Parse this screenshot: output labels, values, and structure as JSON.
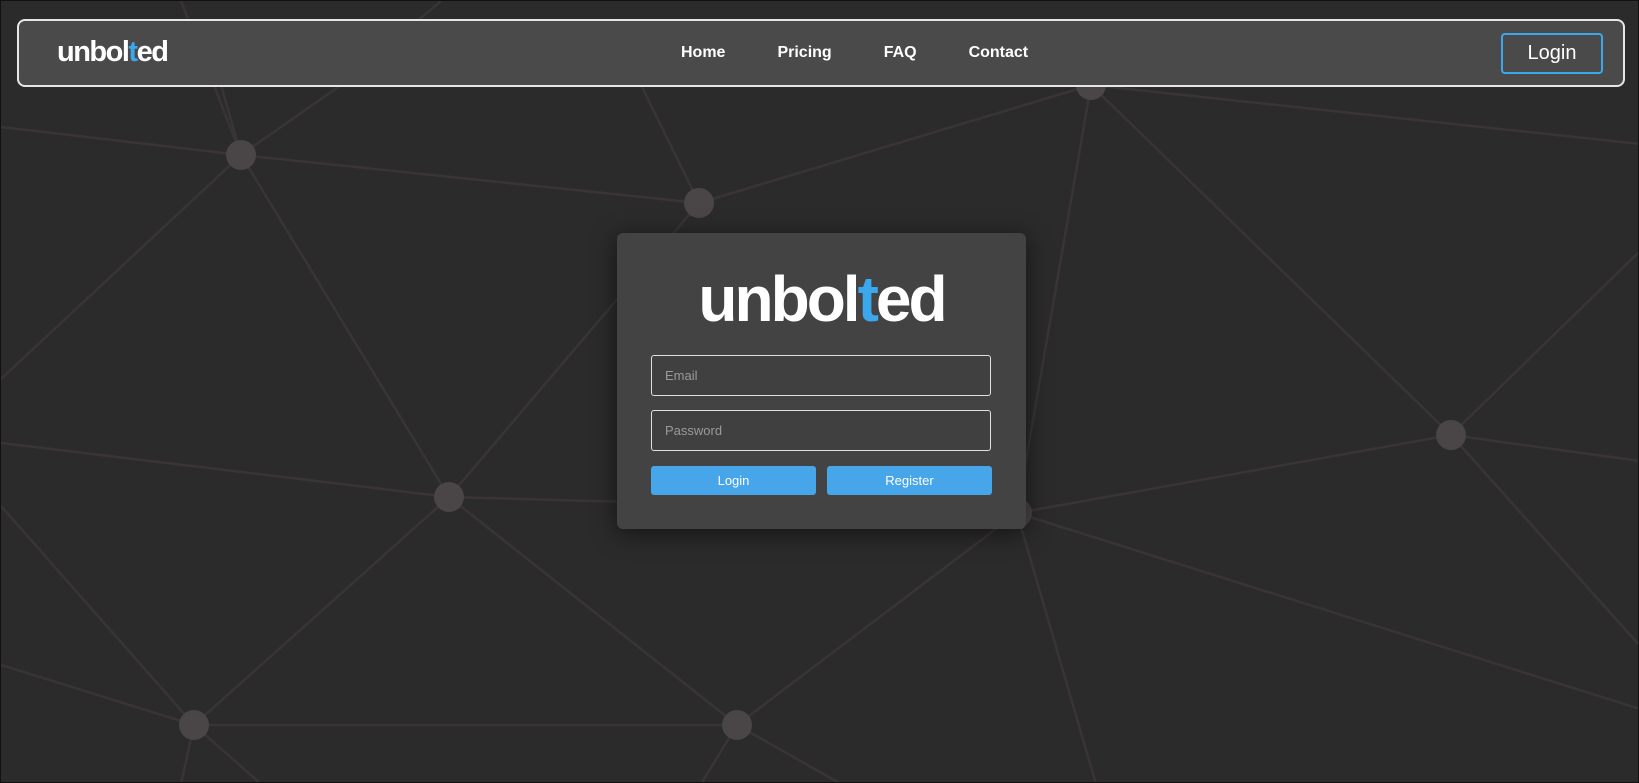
{
  "brand": {
    "prefix": "unbol",
    "accent_letter": "t",
    "suffix": "ed",
    "accent_color": "#3ba7ec"
  },
  "nav": {
    "links": [
      {
        "label": "Home"
      },
      {
        "label": "Pricing"
      },
      {
        "label": "FAQ"
      },
      {
        "label": "Contact"
      }
    ],
    "login_label": "Login"
  },
  "form": {
    "email_placeholder": "Email",
    "email_value": "",
    "password_placeholder": "Password",
    "password_value": "",
    "login_label": "Login",
    "register_label": "Register"
  },
  "colors": {
    "background": "#2b2b2b",
    "network_line": "#3a3435",
    "network_node": "#4a4546",
    "button": "#47a5ea"
  }
}
